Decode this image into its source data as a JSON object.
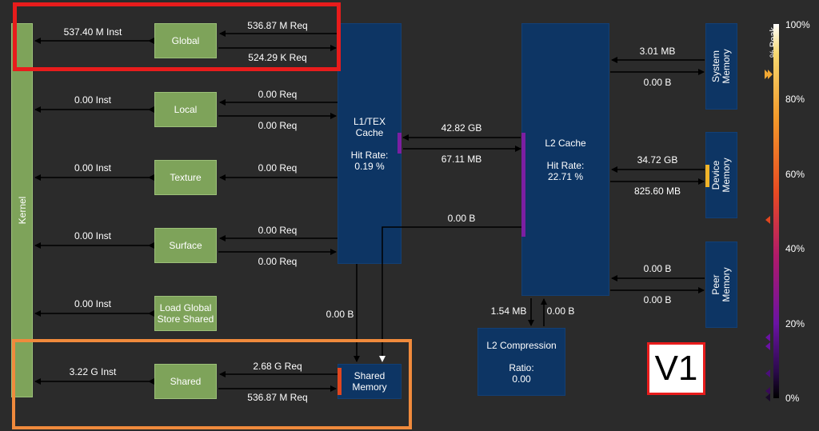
{
  "kernel": {
    "label": "Kernel"
  },
  "units": {
    "global": "Global",
    "local": "Local",
    "texture": "Texture",
    "surface": "Surface",
    "ldgsts_line1": "Load Global",
    "ldgsts_line2": "Store Shared",
    "shared": "Shared"
  },
  "instructions": {
    "global": "537.40 M Inst",
    "local": "0.00 Inst",
    "texture": "0.00 Inst",
    "surface": "0.00 Inst",
    "ldgsts": "0.00 Inst",
    "shared": "3.22 G Inst"
  },
  "requests": {
    "global_in": "536.87 M Req",
    "global_out": "524.29 K Req",
    "local_in": "0.00 Req",
    "local_out": "0.00 Req",
    "texture": "0.00 Req",
    "surface_in": "0.00 Req",
    "surface_out": "0.00 Req",
    "shared_in": "2.68 G Req",
    "shared_out": "536.87 M Req"
  },
  "l1": {
    "line1": "L1/TEX",
    "line2": "Cache",
    "hit_label": "Hit Rate:",
    "hit_value": "0.19 %"
  },
  "l2": {
    "title": "L2 Cache",
    "hit_label": "Hit Rate:",
    "hit_value": "22.71 %"
  },
  "l1_l2": {
    "in": "42.82 GB",
    "out": "67.11 MB",
    "direct": "0.00 B"
  },
  "l1_shared": {
    "value": "0.00 B"
  },
  "shared_memory": {
    "line1": "Shared",
    "line2": "Memory"
  },
  "l2_compression": {
    "title": "L2 Compression",
    "ratio_label": "Ratio:",
    "ratio_value": "0.00",
    "in": "1.54 MB",
    "out": "0.00 B"
  },
  "system_memory": {
    "line1": "System",
    "line2": "Memory",
    "in": "3.01 MB",
    "out": "0.00 B"
  },
  "device_memory": {
    "line1": "Device",
    "line2": "Memory",
    "in": "34.72 GB",
    "out": "825.60 MB"
  },
  "peer_memory": {
    "line1": "Peer",
    "line2": "Memory",
    "in": "0.00 B",
    "out": "0.00 B"
  },
  "legend": {
    "title": "% Peak",
    "ticks": [
      "100%",
      "80%",
      "60%",
      "40%",
      "20%",
      "0%"
    ]
  },
  "annotation": {
    "version": "V1"
  },
  "colors": {
    "background": "#2b2b2b",
    "unit_green": "#7ea35a",
    "block_navy": "#0d3564",
    "highlight_red": "#e81c1c",
    "highlight_orange": "#f08a3c"
  }
}
